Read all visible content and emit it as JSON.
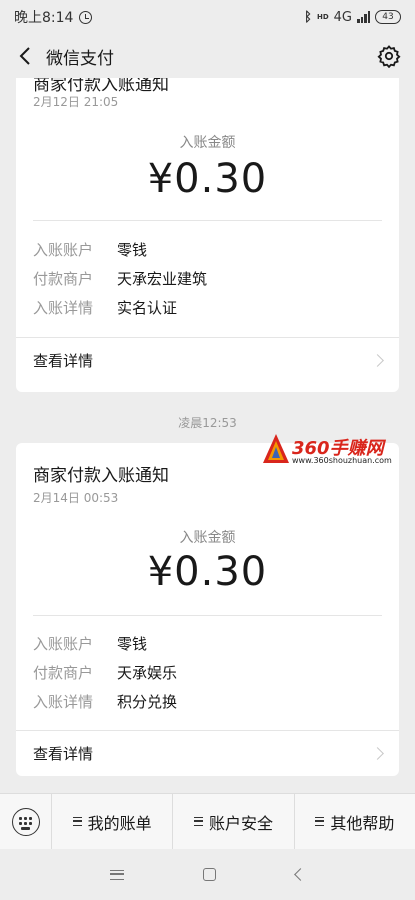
{
  "status_bar": {
    "time": "晚上8:14",
    "network": "4G",
    "hd": "HD",
    "battery": "43"
  },
  "header": {
    "title": "微信支付"
  },
  "cards": [
    {
      "title": "商家付款入账通知",
      "date": "2月12日  21:05",
      "amount_label": "入账金额",
      "amount": "¥0.30",
      "rows": [
        {
          "key": "入账账户",
          "value": "零钱"
        },
        {
          "key": "付款商户",
          "value": "天承宏业建筑"
        },
        {
          "key": "入账详情",
          "value": "实名认证"
        }
      ],
      "link": "查看详情"
    },
    {
      "title": "商家付款入账通知",
      "date": "2月14日  00:53",
      "amount_label": "入账金额",
      "amount": "¥0.30",
      "rows": [
        {
          "key": "入账账户",
          "value": "零钱"
        },
        {
          "key": "付款商户",
          "value": "天承娱乐"
        },
        {
          "key": "入账详情",
          "value": "积分兑换"
        }
      ],
      "link": "查看详情"
    }
  ],
  "separator_time": "凌晨12:53",
  "watermark": {
    "text": "360手赚网",
    "url": "www.360shouzhuan.com"
  },
  "bottom_menu": {
    "items": [
      "我的账单",
      "账户安全",
      "其他帮助"
    ]
  },
  "colors": {
    "background": "#ededed",
    "card": "#ffffff",
    "watermark": "#d9261c"
  }
}
